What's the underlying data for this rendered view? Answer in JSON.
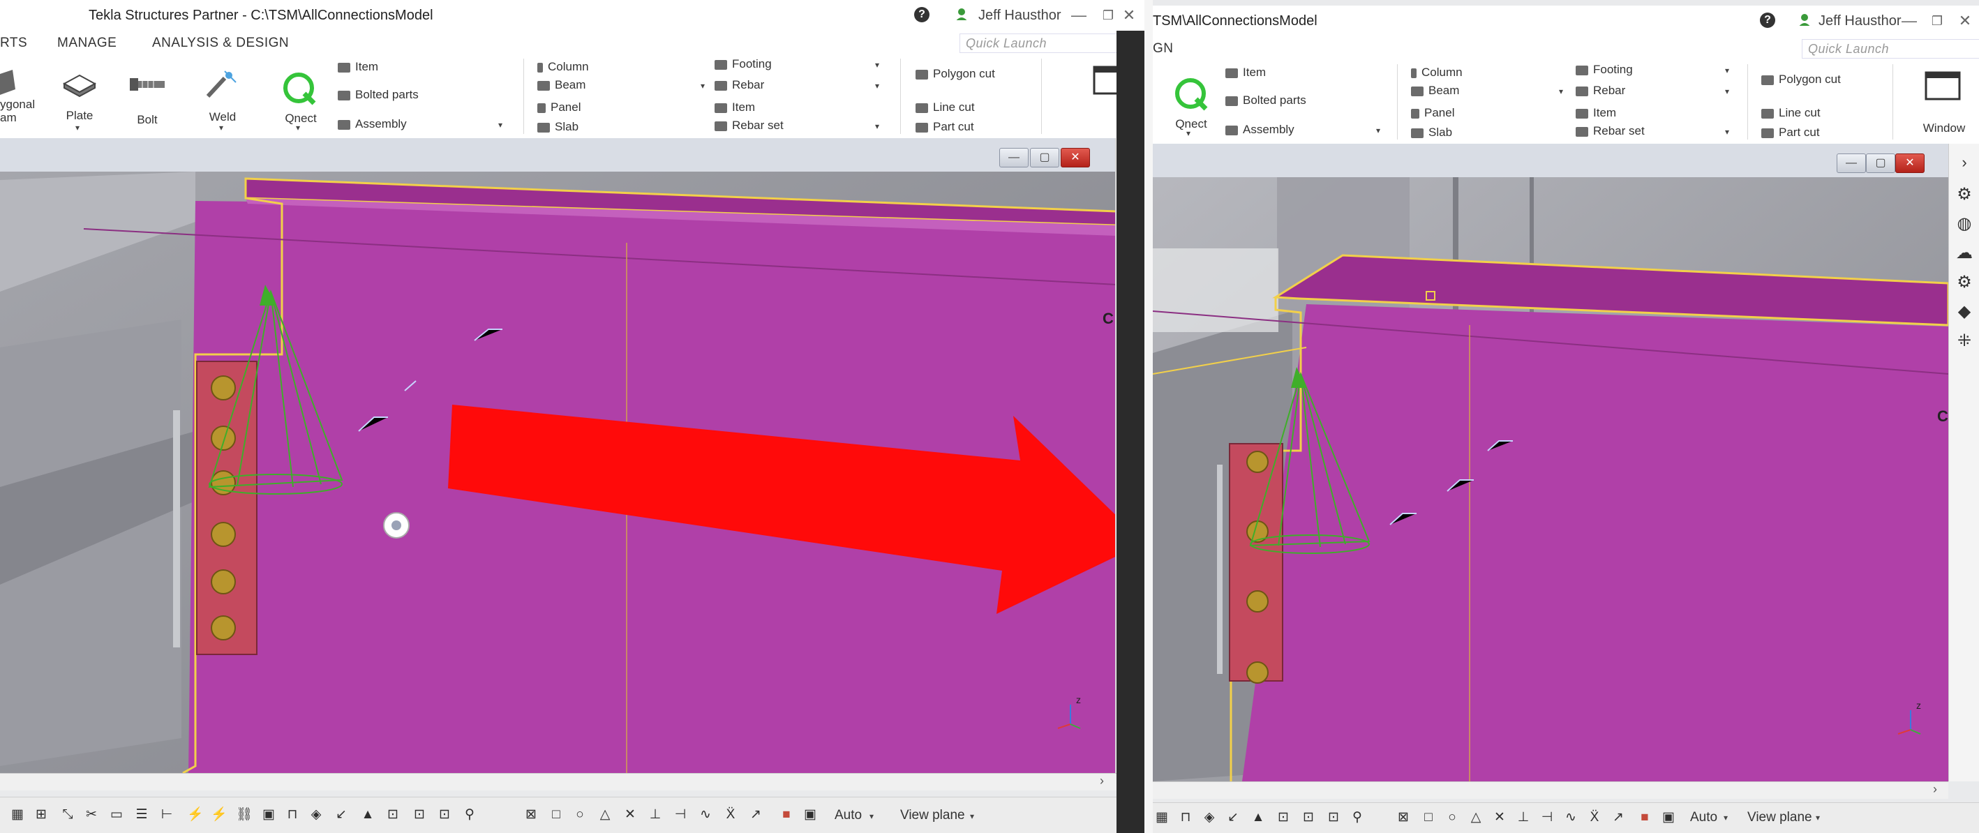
{
  "left": {
    "title": "Tekla Structures Partner - C:\\TSM\\AllConnectionsModel",
    "user": "Jeff Hausthor",
    "quick_launch_placeholder": "Quick Launch",
    "menu": [
      "RTS",
      "MANAGE",
      "ANALYSIS & DESIGN"
    ],
    "ribbon": {
      "big": [
        "ygonal\nam",
        "Plate",
        "Bolt",
        "Weld",
        "Qnect"
      ],
      "group1": [
        "Item",
        "Bolted parts",
        "Assembly"
      ],
      "group2": [
        "Column",
        "Beam",
        "Panel",
        "Slab"
      ],
      "group3": [
        "Footing",
        "Rebar",
        "Item",
        "Rebar set"
      ],
      "group4": [
        "Polygon cut",
        "Line cut",
        "Part cut"
      ],
      "window": "Window"
    },
    "viewport_letter": "C",
    "status": {
      "auto": "Auto",
      "view_plane": "View plane"
    }
  },
  "right": {
    "title": "TSM\\AllConnectionsModel",
    "user": "Jeff Hausthor",
    "quick_launch_placeholder": "Quick Launch",
    "menu": [
      "GN"
    ],
    "ribbon": {
      "big": [
        "Qnect"
      ],
      "group1": [
        "Item",
        "Bolted parts",
        "Assembly"
      ],
      "group2": [
        "Column",
        "Beam",
        "Panel",
        "Slab"
      ],
      "group3": [
        "Footing",
        "Rebar",
        "Item",
        "Rebar set"
      ],
      "group4": [
        "Polygon cut",
        "Line cut",
        "Part cut"
      ],
      "window": "Window"
    },
    "viewport_letter": "C",
    "status": {
      "auto": "Auto",
      "view_plane": "View plane"
    }
  },
  "colors": {
    "beam": "#b040a8",
    "beam_top": "#9a2f8e",
    "arrow": "#ff0a0a",
    "selection": "#f2d04a",
    "cone": "#3fae2a",
    "bolt": "#b8952e"
  },
  "icons": [
    "help-icon",
    "user-icon",
    "minimize-icon",
    "maximize-icon",
    "close-icon",
    "search-icon",
    "plate-icon",
    "bolt-icon",
    "weld-icon",
    "qnect-icon",
    "window-icon",
    "settings-icon",
    "globe-icon",
    "cloud-icon",
    "gear-icon",
    "cube-icon",
    "components-icon"
  ]
}
